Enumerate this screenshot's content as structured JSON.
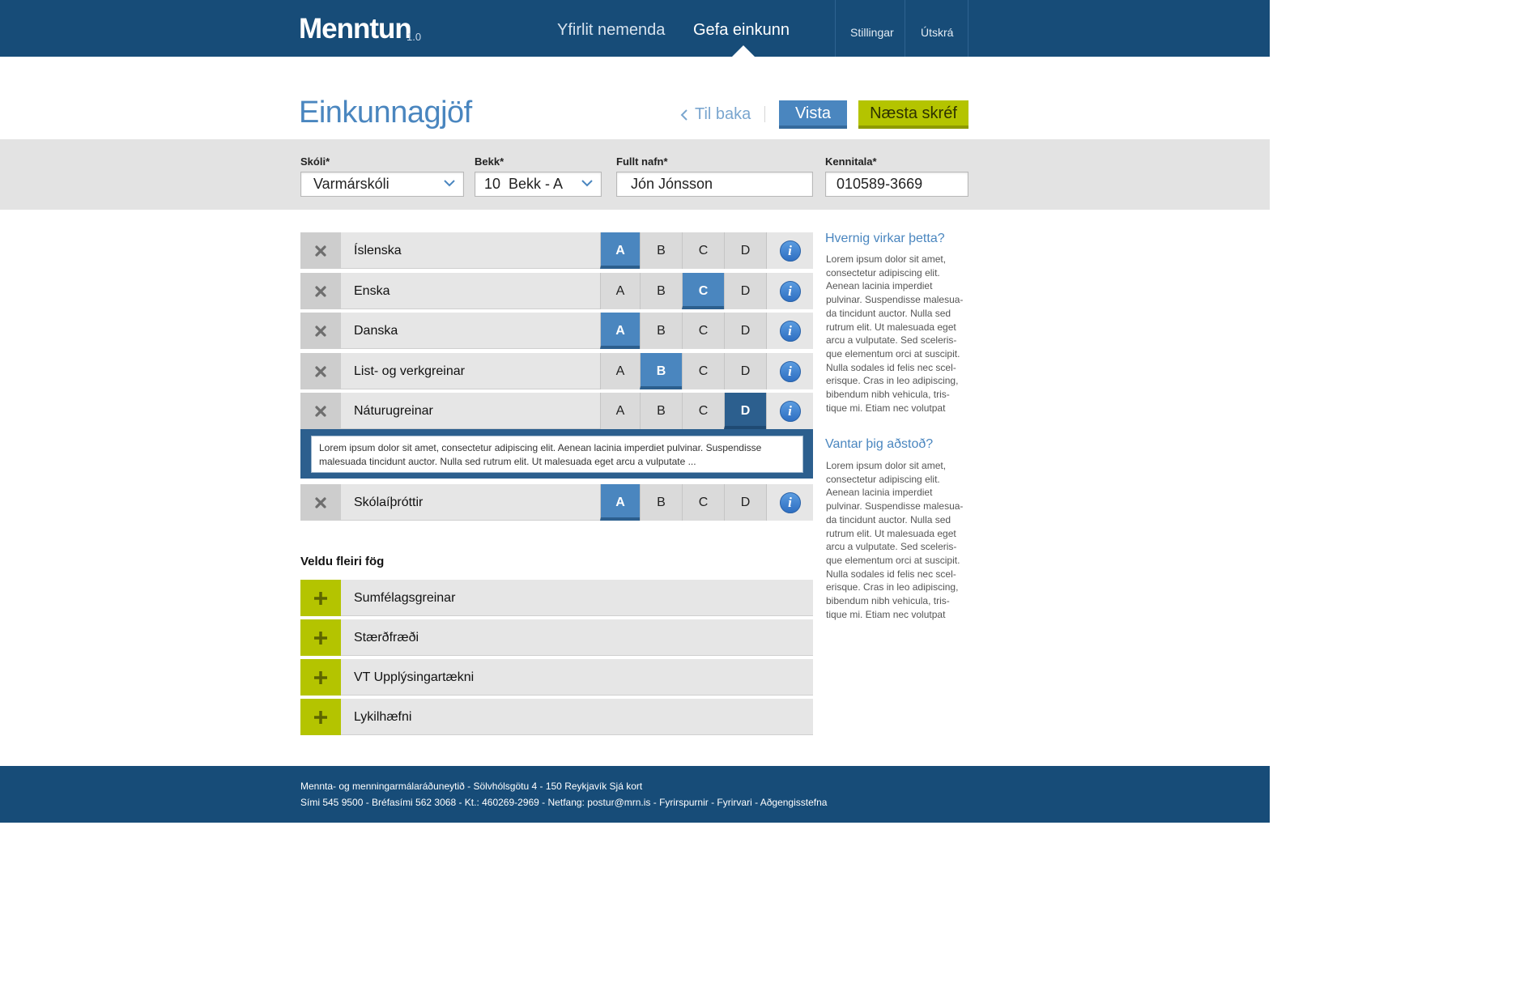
{
  "header": {
    "logo": "Menntun",
    "version": "1.0",
    "nav": [
      {
        "label": "Yfirlit nemenda",
        "active": false
      },
      {
        "label": "Gefa einkunn",
        "active": true
      }
    ],
    "utility": [
      "Stillingar",
      "Útskrá"
    ]
  },
  "page": {
    "title": "Einkunnagjöf",
    "back_label": "Til baka",
    "save_label": "Vista",
    "next_label": "Næsta skréf"
  },
  "form": {
    "school": {
      "label": "Skóli*",
      "value": "Varmárskóli"
    },
    "class": {
      "label": "Bekk*",
      "value": "10  Bekk - A"
    },
    "name": {
      "label": "Fullt nafn*",
      "value": "Jón Jónsson"
    },
    "ssn": {
      "label": "Kennitala*",
      "value": "010589-3669"
    }
  },
  "grade_options": [
    "A",
    "B",
    "C",
    "D"
  ],
  "subjects": [
    {
      "name": "Íslenska",
      "grade": "A"
    },
    {
      "name": "Enska",
      "grade": "C"
    },
    {
      "name": "Danska",
      "grade": "A"
    },
    {
      "name": "List- og verkgreinar",
      "grade": "B"
    },
    {
      "name": "Náturugreinar",
      "grade": "D"
    },
    {
      "name": "Skólaíþróttir",
      "grade": "A"
    }
  ],
  "comment": {
    "line1": "Lorem ipsum dolor sit amet, consectetur adipiscing elit. Aenean lacinia imperdiet pulvinar. Suspendisse",
    "line2": "malesuada tincidunt auctor. Nulla sed rutrum elit. Ut malesuada eget arcu a vulputate ..."
  },
  "more": {
    "title": "Veldu fleiri fög",
    "items": [
      "Sumfélagsgreinar",
      "Stærðfræði",
      "VT Upplýsingartækni",
      "Lykilhæfni"
    ]
  },
  "sidebar": {
    "how_title": "Hvernig virkar þetta?",
    "how_lines": [
      "Lorem ipsum dolor sit amet,",
      "consectetur adipiscing elit.",
      "Aenean lacinia imperdiet",
      "pulvinar. Suspendisse malesua-",
      "da tincidunt auctor. Nulla sed",
      "rutrum elit. Ut malesuada eget",
      "arcu a vulputate. Sed sceleris-",
      "que elementum orci at suscipit.",
      "Nulla sodales id felis nec scel-",
      "erisque. Cras in leo adipiscing,",
      "bibendum nibh vehicula, tris-",
      "tique mi. Etiam nec volutpat"
    ],
    "help_title": "Vantar þig aðstoð?",
    "help_lines": [
      "Lorem ipsum dolor sit amet,",
      "consectetur adipiscing elit.",
      "Aenean lacinia imperdiet",
      "pulvinar. Suspendisse malesua-",
      "da tincidunt auctor. Nulla sed",
      "rutrum elit. Ut malesuada eget",
      "arcu a vulputate. Sed sceleris-",
      "que elementum orci at suscipit.",
      "Nulla sodales id felis nec scel-",
      "erisque. Cras in leo adipiscing,",
      "bibendum nibh vehicula, tris-",
      "tique mi. Etiam nec volutpat"
    ]
  },
  "footer": {
    "line1": "Mennta- og menningarmálaráðuneytið - Sölvhólsgötu 4 - 150 Reykjavík Sjá kort",
    "line2": "Sími 545 9500 - Bréfasími 562 3068 - Kt.: 460269-2969 - Netfang: postur@mrn.is - Fyrirspurnir - Fyrirvari - Aðgengisstefna"
  },
  "colors": {
    "primary": "#174c78",
    "accent_blue": "#4a86bf",
    "accent_green": "#b4c400"
  }
}
